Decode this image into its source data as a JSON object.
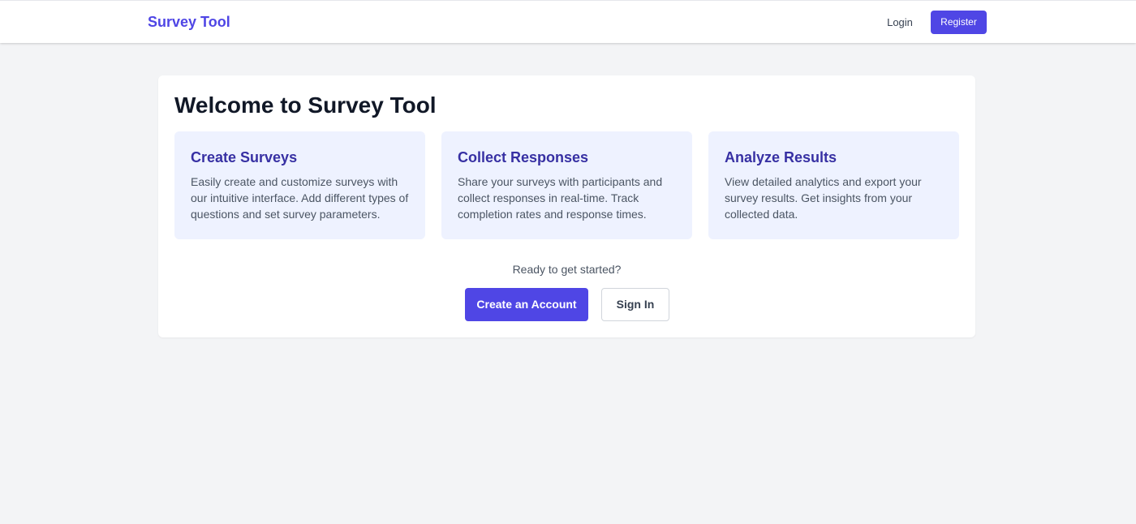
{
  "navbar": {
    "brand": "Survey Tool",
    "login_label": "Login",
    "register_label": "Register"
  },
  "main": {
    "title": "Welcome to Survey Tool",
    "features": [
      {
        "title": "Create Surveys",
        "description": "Easily create and customize surveys with our intuitive interface. Add different types of questions and set survey parameters."
      },
      {
        "title": "Collect Responses",
        "description": "Share your surveys with participants and collect responses in real-time. Track completion rates and response times."
      },
      {
        "title": "Analyze Results",
        "description": "View detailed analytics and export your survey results. Get insights from your collected data."
      }
    ],
    "cta_text": "Ready to get started?",
    "create_account_label": "Create an Account",
    "sign_in_label": "Sign In"
  },
  "colors": {
    "accent": "#4f46e5",
    "feature_bg": "#eef2ff",
    "feature_title": "#3730a3",
    "page_bg": "#f3f4f6"
  }
}
